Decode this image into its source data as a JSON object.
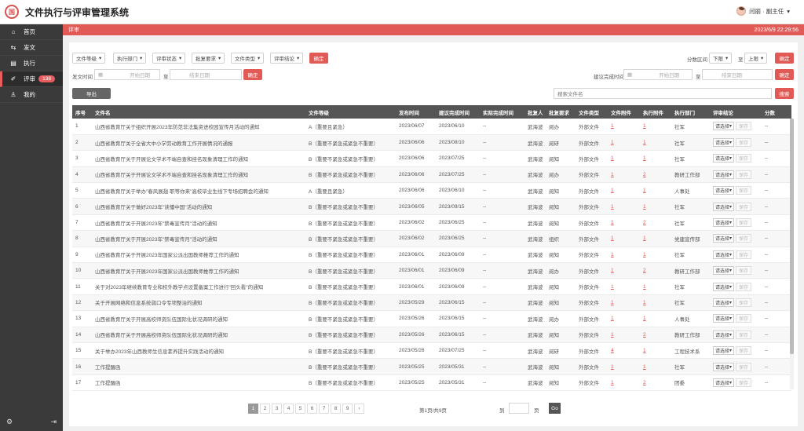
{
  "app": {
    "logo_text": "国",
    "title": "文件执行与评审管理系统"
  },
  "user": {
    "name": "闫丽 · 副主任",
    "caret": "▾"
  },
  "sidebar": {
    "items": [
      {
        "icon": "⌂",
        "label": "首页"
      },
      {
        "icon": "⇆",
        "label": "发文"
      },
      {
        "icon": "▤",
        "label": "执行"
      },
      {
        "icon": "✐",
        "label": "评审",
        "badge": "138"
      },
      {
        "icon": "♙",
        "label": "我的"
      }
    ],
    "bottom_left": "⚙",
    "bottom_right": "⇥"
  },
  "breadcrumb": {
    "label": "评审",
    "datetime": "2023/6/9 22:29:56"
  },
  "filters": {
    "dropdowns": [
      "文件等级",
      "执行部门",
      "评审状态",
      "批复要求",
      "文件类型",
      "评审结论"
    ],
    "caret": "▾",
    "confirm": "确定",
    "score_label": "分数区间",
    "score_low": "下限",
    "score_to": "至",
    "score_high": "上限",
    "send_time_label": "发文时间",
    "start_date": "开始日期",
    "end_date": "结束日期",
    "date_to": "至",
    "suggest_label": "建议完成时间",
    "export": "导出",
    "search_placeholder": "搜索文件名",
    "search_btn": "搜索"
  },
  "table": {
    "headers": [
      "序号",
      "文件名",
      "文件等级",
      "发布时间",
      "建议完成时间",
      "实际完成时间",
      "批复人",
      "批复要求",
      "文件类型",
      "文件附件",
      "执行附件",
      "执行部门",
      "评审结论",
      "分数"
    ],
    "select_label": "请选择",
    "save_label": "保存",
    "rows": [
      [
        "1",
        "山西省教育厅关于组织开展2023年防范非法集资进校园宣传月活动的通知",
        "A（重要且紧急）",
        "2023/06/07",
        "2023/06/10",
        "--",
        "武海波",
        "阅办",
        "外部文件",
        "1",
        "1",
        "社军",
        "--"
      ],
      [
        "2",
        "山西省教育厅关于全省大中小学劳动教育工作开展情况的通报",
        "B（重要不紧急或紧急不重要）",
        "2023/06/06",
        "2023/08/10",
        "--",
        "武海波",
        "阅研",
        "外部文件",
        "1",
        "1",
        "社军",
        "--"
      ],
      [
        "3",
        "山西省教育厅关于开展论文学术不端自查和挂名现象清理工作的通知",
        "B（重要不紧急或紧急不重要）",
        "2023/06/06",
        "2023/07/25",
        "--",
        "武海波",
        "阅知",
        "外部文件",
        "1",
        "1",
        "社军",
        "--"
      ],
      [
        "4",
        "山西省教育厅关于开展论文学术不端自查和挂名现象清理工作的通知",
        "B（重要不紧急或紧急不重要）",
        "2023/06/06",
        "2023/07/25",
        "--",
        "武海波",
        "阅办",
        "外部文件",
        "1",
        "2",
        "教研工作部",
        "--"
      ],
      [
        "5",
        "山西省教育厅关于举办\"春风展翅 职等你来\"高校毕业生线下专场招聘会的通知",
        "A（重要且紧急）",
        "2023/06/06",
        "2023/06/10",
        "--",
        "武海波",
        "阅知",
        "外部文件",
        "1",
        "1",
        "人事处",
        "--"
      ],
      [
        "6",
        "山西省教育厅关于做好2023年\"读懂中国\"活动的通知",
        "B（重要不紧急或紧急不重要）",
        "2023/06/05",
        "2023/09/15",
        "--",
        "武海波",
        "阅知",
        "外部文件",
        "1",
        "1",
        "社军",
        "--"
      ],
      [
        "7",
        "山西省教育厅关于开展2023年\"禁毒宣传月\"活动的通知",
        "B（重要不紧急或紧急不重要）",
        "2023/06/02",
        "2023/06/25",
        "--",
        "武海波",
        "阅知",
        "外部文件",
        "1",
        "2",
        "社军",
        "--"
      ],
      [
        "8",
        "山西省教育厅关于开展2023年\"禁毒宣传月\"活动的通知",
        "B（重要不紧急或紧急不重要）",
        "2023/06/02",
        "2023/06/25",
        "--",
        "武海波",
        "组织",
        "外部文件",
        "1",
        "1",
        "党建宣传部",
        "--"
      ],
      [
        "9",
        "山西省教育厅关于开展2023年国家公派出国教师推荐工作的通知",
        "B（重要不紧急或紧急不重要）",
        "2023/06/01",
        "2023/06/09",
        "--",
        "武海波",
        "阅知",
        "外部文件",
        "1",
        "1",
        "社军",
        "--"
      ],
      [
        "10",
        "山西省教育厅关于开展2023年国家公派出国教师推荐工作的通知",
        "B（重要不紧急或紧急不重要）",
        "2023/06/01",
        "2023/06/09",
        "--",
        "武海波",
        "阅办",
        "外部文件",
        "1",
        "2",
        "教研工作部",
        "--"
      ],
      [
        "11",
        "关于对2023年继续教育专业和校外教学点设置备案工作进行\"回头看\"的通知",
        "B（重要不紧急或紧急不重要）",
        "2023/06/01",
        "2023/06/09",
        "--",
        "武海波",
        "阅知",
        "外部文件",
        "1",
        "1",
        "社军",
        "--"
      ],
      [
        "12",
        "关于开展网络和信息系统弱口令专项整治的通知",
        "B（重要不紧急或紧急不重要）",
        "2023/05/29",
        "2023/06/15",
        "--",
        "武海波",
        "阅知",
        "外部文件",
        "1",
        "1",
        "社军",
        "--"
      ],
      [
        "13",
        "山西省教育厅关于开展高校师资队伍国际化状况调研的通知",
        "B（重要不紧急或紧急不重要）",
        "2023/05/26",
        "2023/06/15",
        "--",
        "武海波",
        "阅办",
        "外部文件",
        "1",
        "1",
        "人事处",
        "--"
      ],
      [
        "14",
        "山西省教育厅关于开展高校师资队伍国际化状况调研的通知",
        "B（重要不紧急或紧急不重要）",
        "2023/05/26",
        "2023/06/15",
        "--",
        "武海波",
        "阅知",
        "外部文件",
        "1",
        "2",
        "教研工作部",
        "--"
      ],
      [
        "15",
        "关于举办2023年山西教师生信息素养提升实践活动的通知",
        "B（重要不紧急或紧急不重要）",
        "2023/05/26",
        "2023/07/25",
        "--",
        "武海波",
        "阅研",
        "外部文件",
        "4",
        "1",
        "工程技术系",
        "--"
      ],
      [
        "16",
        "工作提醒函",
        "B（重要不紧急或紧急不重要）",
        "2023/05/25",
        "2023/05/31",
        "--",
        "武海波",
        "阅知",
        "外部文件",
        "1",
        "1",
        "社军",
        "--"
      ],
      [
        "17",
        "工作提醒函",
        "B（重要不紧急或紧急不重要）",
        "2023/05/25",
        "2023/05/31",
        "--",
        "武海波",
        "阅知",
        "外部文件",
        "1",
        "2",
        "团委",
        "--"
      ]
    ]
  },
  "pagination": {
    "pages": [
      "1",
      "2",
      "3",
      "4",
      "5",
      "6",
      "7",
      "8",
      "9"
    ],
    "next": "›",
    "info": "第1页/共9页",
    "goto_prefix": "到",
    "goto_suffix": "页",
    "go": "Go"
  },
  "colors": {
    "accent": "#e25a55",
    "sidebar": "#3a3a3a",
    "table_header": "#555555"
  }
}
